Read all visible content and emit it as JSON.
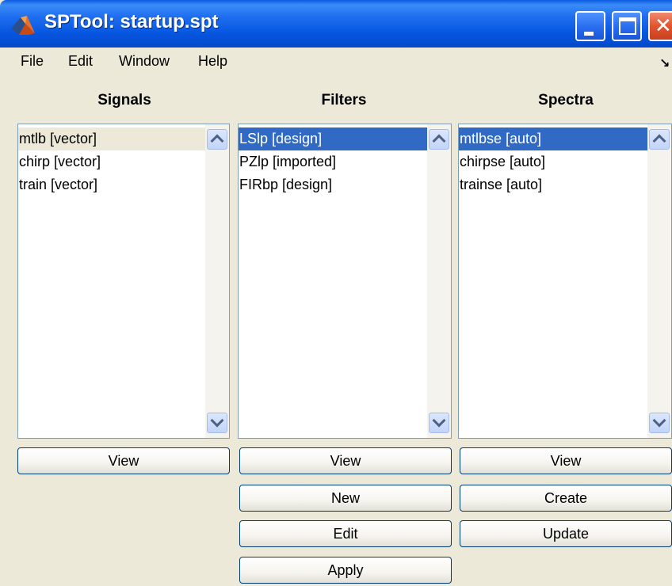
{
  "window": {
    "title": "SPTool: startup.spt"
  },
  "menu": {
    "file": "File",
    "edit": "Edit",
    "window": "Window",
    "help": "Help",
    "dock_icon": "dock-arrow-icon"
  },
  "signals": {
    "header": "Signals",
    "items": [
      "mtlb [vector]",
      "chirp [vector]",
      "train [vector]"
    ],
    "selected_index": 0,
    "view_label": "View"
  },
  "filters": {
    "header": "Filters",
    "items": [
      "LSlp [design]",
      "PZlp [imported]",
      "FIRbp [design]"
    ],
    "selected_index": 0,
    "view_label": "View",
    "new_label": "New",
    "edit_label": "Edit",
    "apply_label": "Apply"
  },
  "spectra": {
    "header": "Spectra",
    "items": [
      "mtlbse [auto]",
      "chirpse [auto]",
      "trainse [auto]"
    ],
    "selected_index": 0,
    "view_label": "View",
    "create_label": "Create",
    "update_label": "Update"
  },
  "colors": {
    "titlebar": "#0656e0",
    "selection": "#316ac5",
    "face": "#ece9d8"
  }
}
